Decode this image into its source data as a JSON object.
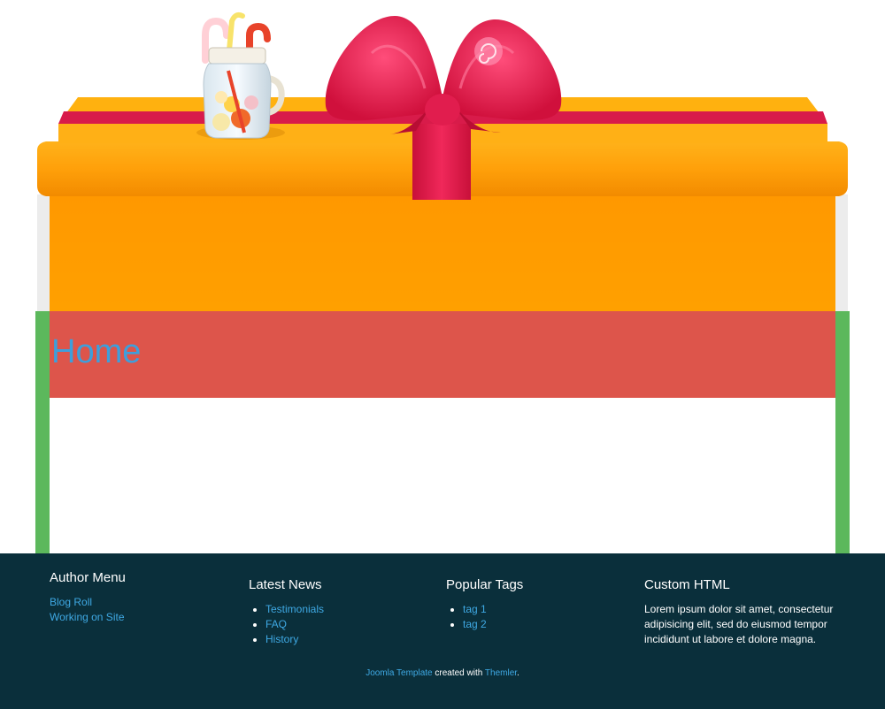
{
  "page": {
    "title": "Home"
  },
  "footer": {
    "author_menu": {
      "heading": "Author Menu",
      "links": [
        "Blog Roll",
        "Working on Site"
      ]
    },
    "latest_news": {
      "heading": "Latest News",
      "items": [
        "Testimonials",
        "FAQ",
        "History"
      ]
    },
    "popular_tags": {
      "heading": "Popular Tags",
      "items": [
        "tag 1",
        "tag 2"
      ]
    },
    "custom_html": {
      "heading": "Custom HTML",
      "text": "Lorem ipsum dolor sit amet, consectetur adipisicing elit, sed do eiusmod tempor incididunt ut labore et dolore magna."
    },
    "credits": {
      "link1": "Joomla Template",
      "middle": " created with ",
      "link2": "Themler",
      "end": "."
    }
  },
  "colors": {
    "box_orange": "#ff9e00",
    "ribbon_red": "#dd1f4a",
    "title_band": "#dd554b",
    "title_text": "#3d9fdc",
    "frame_green": "#5cb85c",
    "footer_bg": "#0a2f3b",
    "link_blue": "#3fa9e4"
  },
  "icons": {
    "candy_jar": "candy-jar-icon",
    "gift_bow": "gift-bow-icon"
  }
}
